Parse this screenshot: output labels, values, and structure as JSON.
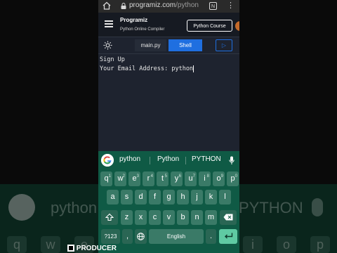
{
  "browser": {
    "url_main": "programiz.com",
    "url_path": "/python"
  },
  "header": {
    "logo": "Programiz",
    "subtitle": "Python Online Compiler",
    "course_button": "Python Course"
  },
  "toolbar": {
    "file_tab": "main.py",
    "shell_tab": "Shell",
    "run_icon": "play-icon"
  },
  "console": {
    "line1": "Sign Up",
    "line2": "Your Email Address: python"
  },
  "keyboard": {
    "suggestions": [
      "python",
      "Python",
      "PYTHON"
    ],
    "row1": [
      {
        "k": "q",
        "h": "1"
      },
      {
        "k": "w",
        "h": "2"
      },
      {
        "k": "e",
        "h": "3"
      },
      {
        "k": "r",
        "h": "4"
      },
      {
        "k": "t",
        "h": "5"
      },
      {
        "k": "y",
        "h": "6"
      },
      {
        "k": "u",
        "h": "7"
      },
      {
        "k": "i",
        "h": "8"
      },
      {
        "k": "o",
        "h": "9"
      },
      {
        "k": "p",
        "h": "0"
      }
    ],
    "row2": [
      "a",
      "s",
      "d",
      "f",
      "g",
      "h",
      "j",
      "k",
      "l"
    ],
    "row3": [
      "z",
      "x",
      "c",
      "v",
      "b",
      "n",
      "m"
    ],
    "sym_key": "?123",
    "comma_key": ",",
    "space_key": "English",
    "period_key": ".",
    "shift_icon": "shift-icon",
    "backspace_icon": "backspace-icon",
    "enter_icon": "enter-icon"
  },
  "background": {
    "words": [
      "python",
      "PYTHON"
    ],
    "keys": [
      "q",
      "w",
      "e",
      "r",
      "t",
      "y",
      "u",
      "i",
      "o",
      "p"
    ]
  },
  "watermark": "PRODUCER",
  "colors": {
    "accent": "#1f6fe0",
    "keyboard_bg": "#0f5a45",
    "key_bg": "#3a7a67",
    "enter_key": "#5fcaa3"
  }
}
